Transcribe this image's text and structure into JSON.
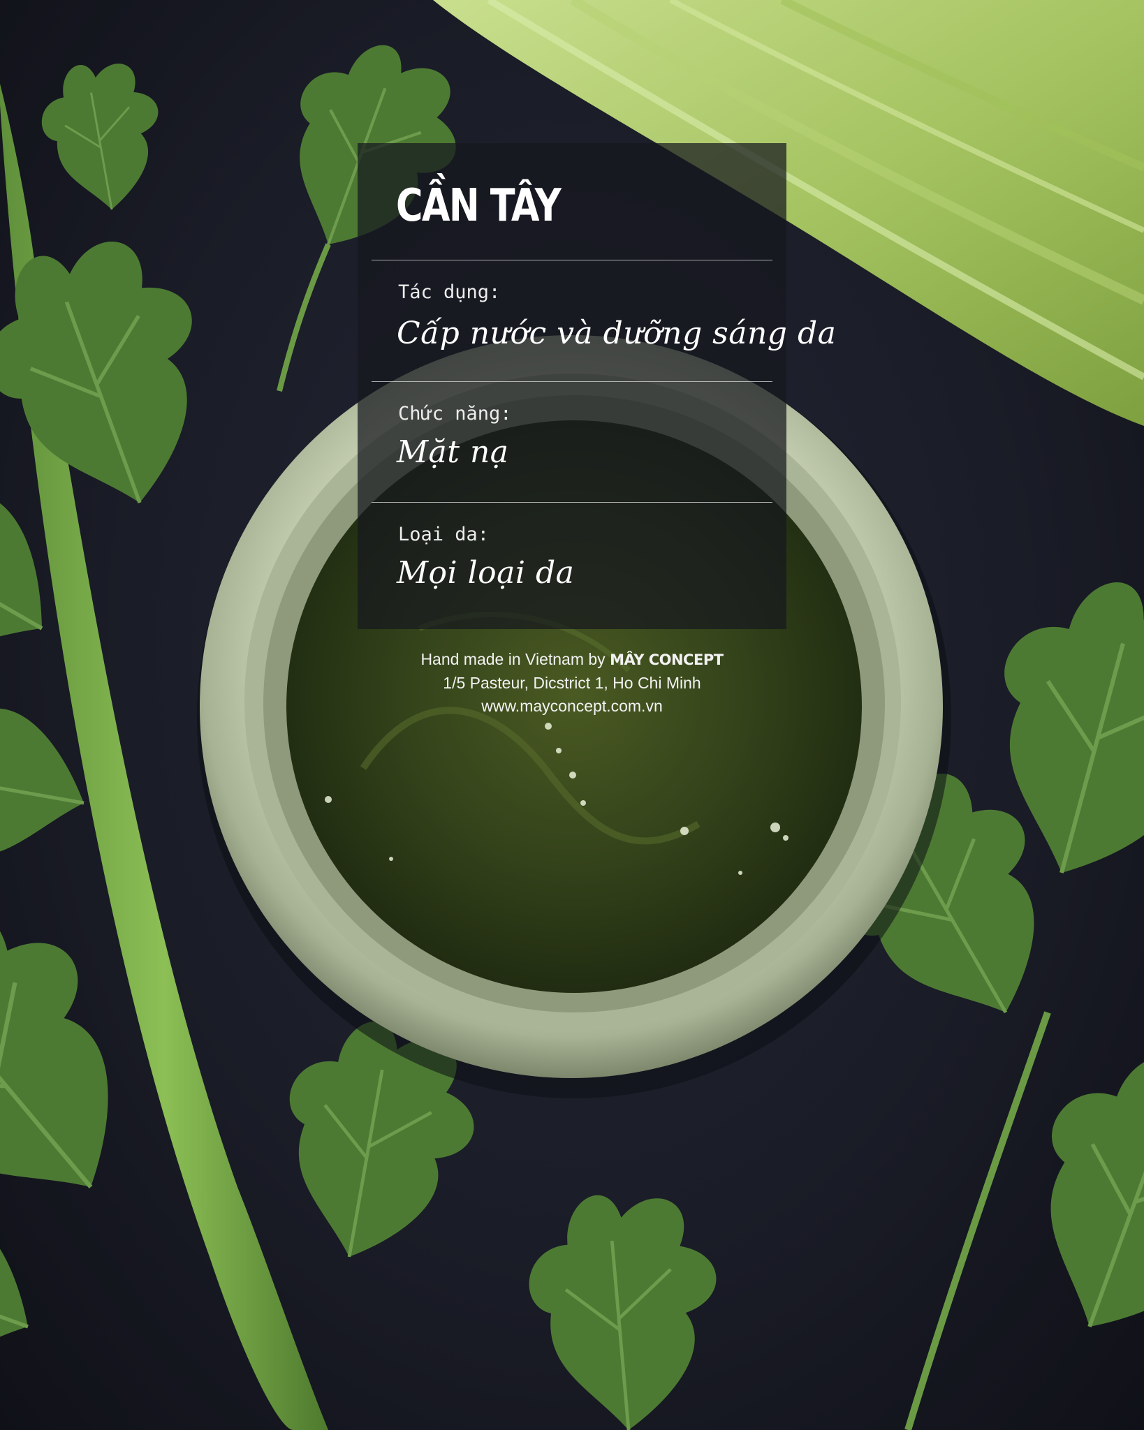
{
  "product": {
    "title": "CẦN TÂY"
  },
  "fields": [
    {
      "label": "Tác dụng:",
      "value": "Cấp nước và dưỡng sáng da"
    },
    {
      "label": "Chức năng:",
      "value": "Mặt nạ"
    },
    {
      "label": "Loại da:",
      "value": "Mọi loại da"
    }
  ],
  "footer": {
    "made_in": "Hand made in Vietnam by ",
    "brand": "MÂY CONCEPT",
    "address": "1/5 Pasteur, Dicstrict 1, Ho Chi Minh",
    "website": "www.mayconcept.com.vn"
  },
  "colors": {
    "background": "#1a1c26",
    "jar": "#b9c3a5",
    "mask": "#3a4a1c",
    "leaf": "#4f7a34",
    "celery": "#a9c76a"
  }
}
